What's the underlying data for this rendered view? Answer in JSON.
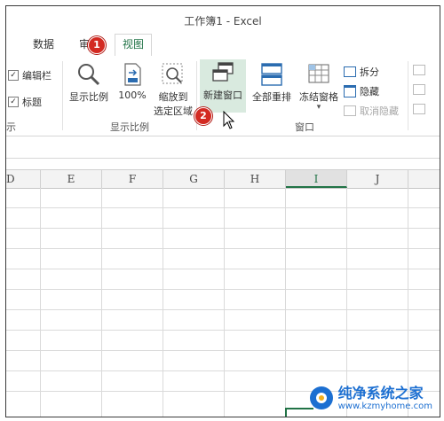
{
  "window": {
    "title": "工作簿1 - Excel"
  },
  "tabs": [
    {
      "label": "数据"
    },
    {
      "label": "审"
    },
    {
      "label": "视图"
    }
  ],
  "show_group": {
    "formula_bar_label": "编辑栏",
    "headings_label": "标题",
    "group_label_fragment": "示"
  },
  "zoom_group": {
    "zoom_label": "显示比例",
    "zoom100_label": "100%",
    "zoom_selection_label_1": "缩放到",
    "zoom_selection_label_2": "选定区域",
    "group_label": "显示比例"
  },
  "window_group": {
    "new_window_label": "新建窗口",
    "arrange_all_label": "全部重排",
    "freeze_panes_label": "冻结窗格",
    "split_label": "拆分",
    "hide_label": "隐藏",
    "unhide_label": "取消隐藏",
    "group_label": "窗口"
  },
  "columns": [
    {
      "label": "D"
    },
    {
      "label": "E"
    },
    {
      "label": "F"
    },
    {
      "label": "G"
    },
    {
      "label": "H"
    },
    {
      "label": "I"
    },
    {
      "label": "J"
    }
  ],
  "badges": {
    "step1": "1",
    "step2": "2"
  },
  "watermark": {
    "line1": "纯净系统之家",
    "line2": "www.kzmyhome.com"
  },
  "colors": {
    "accent": "#217346",
    "badge": "#d32a22",
    "watermark": "#1c6fd1"
  }
}
